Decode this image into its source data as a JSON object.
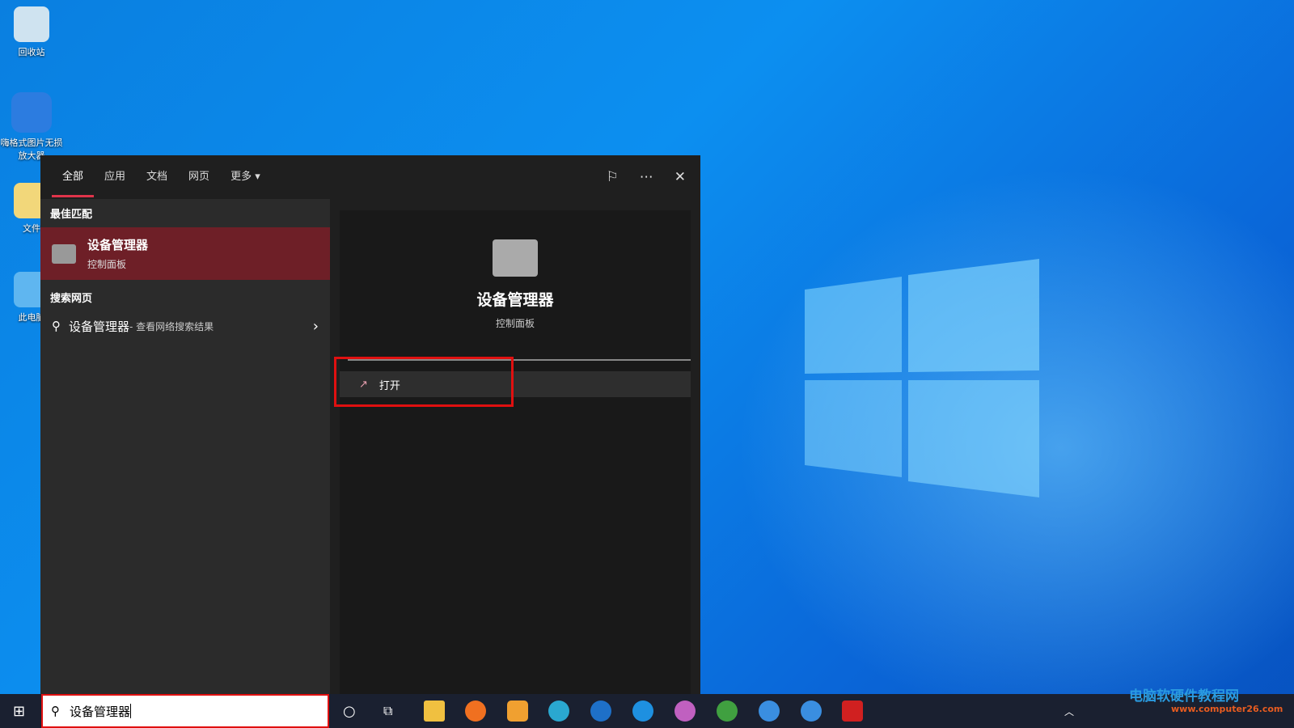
{
  "desktop": {
    "icons": [
      {
        "label": "回收站"
      },
      {
        "label": "嗨格式图片无损放大器"
      },
      {
        "label": "文件"
      },
      {
        "label": "此电脑"
      }
    ]
  },
  "search_panel": {
    "tabs": [
      "全部",
      "应用",
      "文档",
      "网页",
      "更多"
    ],
    "active_tab": "全部",
    "best_match_heading": "最佳匹配",
    "best_match": {
      "title": "设备管理器",
      "subtitle": "控制面板"
    },
    "web_heading": "搜索网页",
    "web_result": {
      "query": "设备管理器",
      "suffix": " - 查看网络搜索结果"
    },
    "detail": {
      "title": "设备管理器",
      "subtitle": "控制面板",
      "open_label": "打开"
    }
  },
  "taskbar": {
    "search_value": "设备管理器"
  },
  "watermark": {
    "title": "电脑软硬件教程网",
    "url": "www.computer26.com"
  },
  "colors": {
    "accent": "#e0344a",
    "selection": "#6e1f27",
    "highlight_box": "#e01010"
  }
}
